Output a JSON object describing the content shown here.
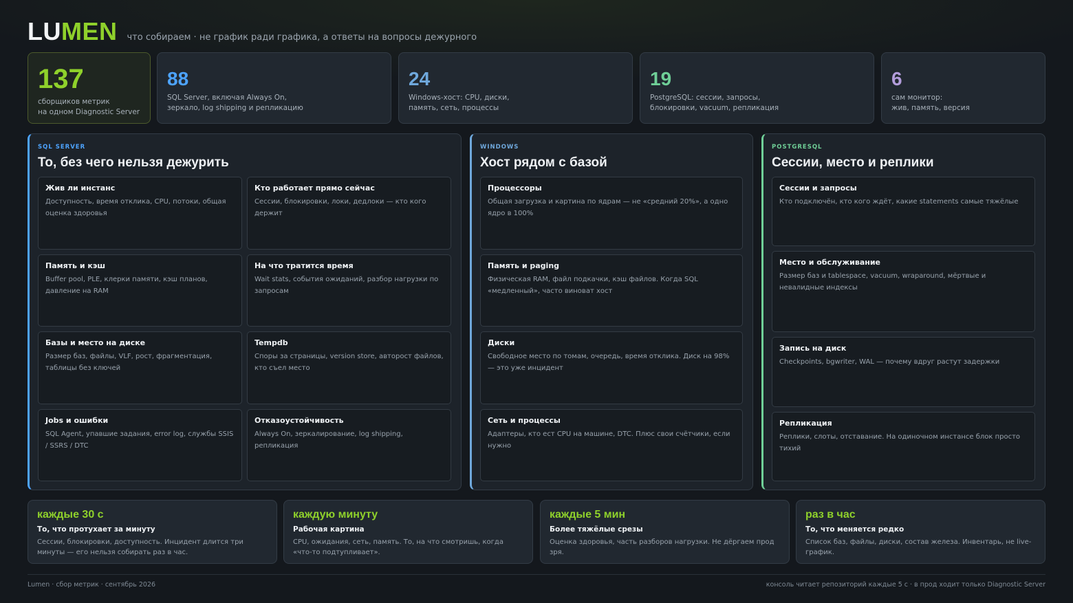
{
  "header": {
    "logo_a": "LU",
    "logo_b": "MEN",
    "tagline": "что собираем · не график ради графика, а ответы на вопросы дежурного"
  },
  "colors": {
    "accent_green": "#8fd12b",
    "sql_blue": "#4da3ff",
    "windows_blue": "#6fa8dc",
    "postgres_green": "#6fcf97",
    "monitor_purple": "#b39ddb"
  },
  "stats": [
    {
      "value": "137",
      "text": "сборщиков метрик\nна одном Diagnostic Server",
      "color": "#8fd12b"
    },
    {
      "value": "88",
      "text": "SQL Server, включая Always On,\nзеркало, log shipping и репликацию",
      "color": "#4da3ff"
    },
    {
      "value": "24",
      "text": "Windows-хост: CPU, диски,\nпамять, сеть, процессы",
      "color": "#6fa8dc"
    },
    {
      "value": "19",
      "text": "PostgreSQL: сессии, запросы,\nблокировки, vacuum, репликация",
      "color": "#6fcf97"
    },
    {
      "value": "6",
      "text": "сам монитор:\nжив, память, версия",
      "color": "#b39ddb"
    }
  ],
  "panels": [
    {
      "tag": "SQL SERVER",
      "title": "То, без чего нельзя дежурить",
      "color": "#4da3ff",
      "cards": [
        {
          "title": "Жив ли инстанс",
          "text": "Доступность, время отклика, CPU, потоки, общая оценка здоровья"
        },
        {
          "title": "Кто работает прямо сейчас",
          "text": "Сессии, блокировки, локи, дедлоки — кто кого держит"
        },
        {
          "title": "Память и кэш",
          "text": "Buffer pool, PLE, клерки памяти, кэш планов, давление на RAM"
        },
        {
          "title": "На что тратится время",
          "text": "Wait stats, события ожиданий, разбор нагрузки по запросам"
        },
        {
          "title": "Базы и место на диске",
          "text": "Размер баз, файлы, VLF, рост, фрагментация, таблицы без ключей"
        },
        {
          "title": "Tempdb",
          "text": "Споры за страницы, version store, автоpост файлов, кто съел место"
        },
        {
          "title": "Jobs и ошибки",
          "text": "SQL Agent, упавшие задания, error log, службы SSIS / SSRS / DTC"
        },
        {
          "title": "Отказоустойчивость",
          "text": "Always On, зеркалирование, log shipping, репликация"
        }
      ]
    },
    {
      "tag": "WINDOWS",
      "title": "Хост рядом с базой",
      "color": "#6fa8dc",
      "cards": [
        {
          "title": "Процессоры",
          "text": "Общая загрузка и картина по ядрам — не «средний 20%», а одно ядро в 100%"
        },
        {
          "title": "Память и paging",
          "text": "Физическая RAM, файл подкачки, кэш файлов. Когда SQL «медленный», часто виноват хост"
        },
        {
          "title": "Диски",
          "text": "Свободное место по томам, очередь, время отклика. Диск на 98% — это уже инцидент"
        },
        {
          "title": "Сеть и процессы",
          "text": "Адаптеры, кто ест CPU на машине, DTC. Плюс свои счётчики, если нужно"
        }
      ]
    },
    {
      "tag": "POSTGRESQL",
      "title": "Сессии, место и реплики",
      "color": "#6fcf97",
      "cards": [
        {
          "title": "Сессии и запросы",
          "text": "Кто подключён, кто кого ждёт, какие statements самые тяжёлые"
        },
        {
          "title": "Место и обслуживание",
          "text": "Размер баз и tablespace, vacuum, wraparound, мёртвые и невалидные индексы"
        },
        {
          "title": "Запись на диск",
          "text": "Checkpoints, bgwriter, WAL — почему вдруг растут задержки"
        },
        {
          "title": "Репликация",
          "text": "Реплики, слоты, отставание. На одиночном инстансе блок просто тихий"
        }
      ]
    }
  ],
  "frequencies": [
    {
      "period": "каждые 30 с",
      "subtitle": "То, что протухает за минуту",
      "text": "Сессии, блокировки, доступность. Инцидент длится три минуты — его нельзя собирать раз в час."
    },
    {
      "period": "каждую минуту",
      "subtitle": "Рабочая картина",
      "text": "CPU, ожидания, сеть, память. То, на что смотришь, когда «что-то подтупливает»."
    },
    {
      "period": "каждые 5 мин",
      "subtitle": "Более тяжёлые срезы",
      "text": "Оценка здоровья, часть разборов нагрузки. Не дёргаем прод зря."
    },
    {
      "period": "раз в час",
      "subtitle": "То, что меняется редко",
      "text": "Список баз, файлы, диски, состав железа. Инвентарь, не live-график."
    }
  ],
  "footer": {
    "left": "Lumen · сбор метрик · сентябрь 2026",
    "right": "консоль читает репозиторий каждые 5 с · в прод ходит только Diagnostic Server"
  }
}
